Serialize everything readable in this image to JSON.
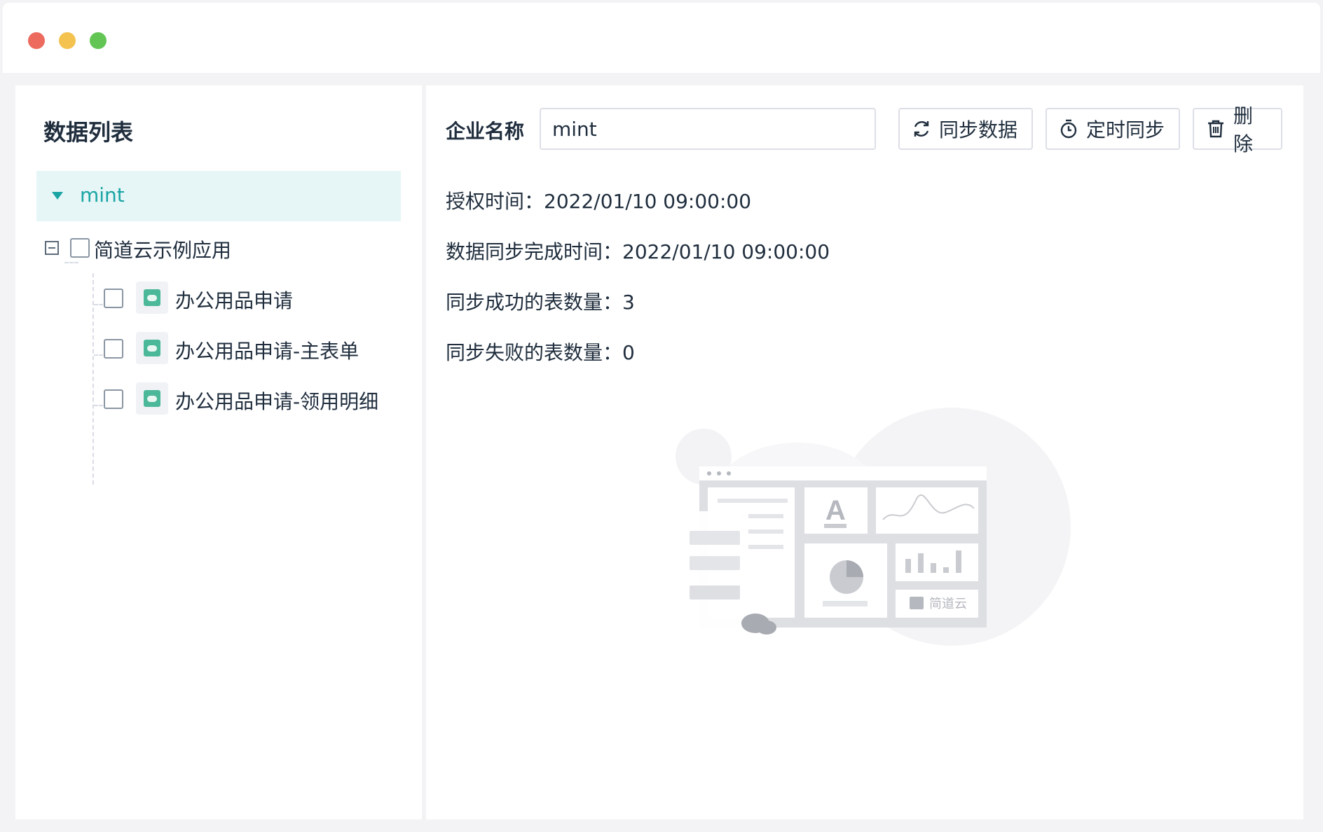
{
  "window": {
    "controls": [
      "close",
      "minimize",
      "maximize"
    ]
  },
  "sidebar": {
    "title": "数据列表",
    "root": {
      "label": "mint",
      "expanded": true,
      "selected": true
    },
    "groups": [
      {
        "label": "简道云示例应用",
        "collapse_icon": "minus-square-icon",
        "items": [
          {
            "label": "办公用品申请",
            "icon": "app-form-icon"
          },
          {
            "label": "办公用品申请-主表单",
            "icon": "app-form-icon"
          },
          {
            "label": "办公用品申请-领用明细",
            "icon": "app-form-icon"
          }
        ]
      }
    ]
  },
  "main": {
    "company_label": "企业名称",
    "company_value": "mint",
    "buttons": {
      "sync": {
        "label": "同步数据",
        "icon": "refresh-icon"
      },
      "timer": {
        "label": "定时同步",
        "icon": "stopwatch-icon"
      },
      "delete": {
        "label": "删除",
        "icon": "trash-icon"
      }
    },
    "info": {
      "auth_time_label": "授权时间：",
      "auth_time_value": "2022/01/10 09:00:00",
      "sync_done_label": "数据同步完成时间：",
      "sync_done_value": "2022/01/10 09:00:00",
      "success_label": "同步成功的表数量：",
      "success_value": "3",
      "fail_label": "同步失败的表数量：",
      "fail_value": "0"
    },
    "illustration": {
      "brand_label": "简道云",
      "letter": "A"
    }
  },
  "colors": {
    "accent": "#19a4a4",
    "selected_bg": "#e6f6f6",
    "app_icon": "#4bb89a",
    "border": "#dcdfe6"
  }
}
